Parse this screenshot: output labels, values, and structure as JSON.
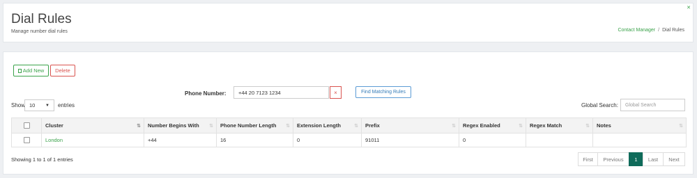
{
  "header": {
    "title": "Dial Rules",
    "subtitle": "Manage number dial rules",
    "breadcrumb": {
      "parent": "Contact Manager",
      "separator": "/",
      "current": "Dial Rules"
    }
  },
  "actions": {
    "add_new": "Add New",
    "delete": "Delete"
  },
  "phone_search": {
    "label": "Phone Number:",
    "value": "+44 20 7123 1234",
    "clear": "×",
    "find_button": "Find Matching Rules"
  },
  "length": {
    "show": "Show",
    "value": "10",
    "entries": "entries"
  },
  "global_search": {
    "label": "Global Search:",
    "placeholder": "Global Search"
  },
  "table": {
    "columns": [
      "Cluster",
      "Number Begins With",
      "Phone Number Length",
      "Extension Length",
      "Prefix",
      "Regex Enabled",
      "Regex Match",
      "Notes"
    ],
    "rows": [
      {
        "cluster": "London",
        "begins_with": "+44",
        "phone_length": "16",
        "ext_length": "0",
        "prefix": "91011",
        "regex_enabled": "0",
        "regex_match": "",
        "notes": ""
      }
    ]
  },
  "info": "Showing 1 to 1 of 1 entries",
  "pagination": {
    "first": "First",
    "previous": "Previous",
    "current": "1",
    "last": "Last",
    "next": "Next"
  },
  "colors": {
    "accent": "#3aa24a",
    "danger": "#d9534f",
    "primary": "#337ab7",
    "active_page": "#0f6b5a"
  }
}
